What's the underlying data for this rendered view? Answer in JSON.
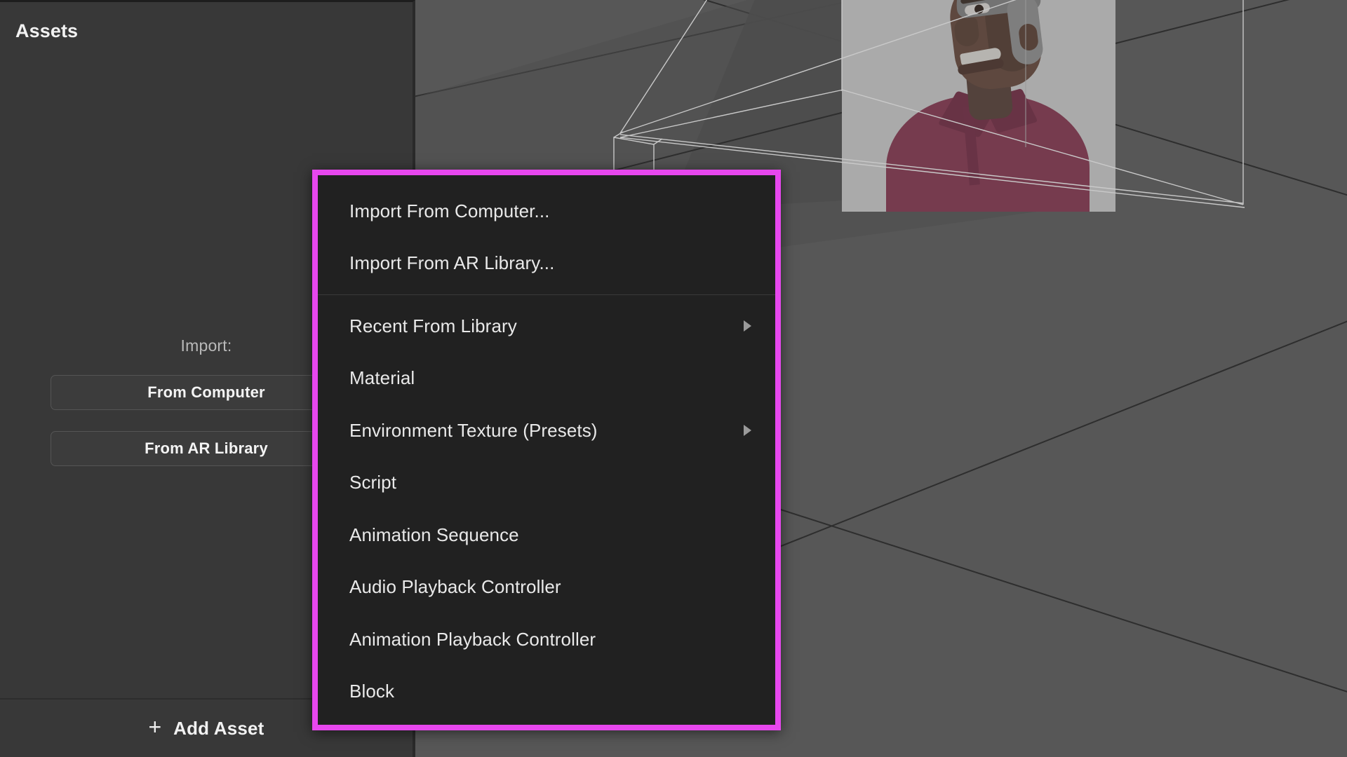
{
  "panel": {
    "title": "Assets",
    "import_label": "Import:",
    "buttons": [
      {
        "label": "From Computer",
        "name": "import-from-computer-button"
      },
      {
        "label": "From AR Library",
        "name": "import-from-ar-library-button"
      }
    ],
    "add_asset": {
      "plus": "+",
      "label": "Add Asset"
    }
  },
  "context_menu": {
    "highlight_color": "#e747ee",
    "background_color": "#212121",
    "groups": [
      {
        "items": [
          {
            "label": "Import From Computer...",
            "submenu": false
          },
          {
            "label": "Import From AR Library...",
            "submenu": false
          }
        ]
      },
      {
        "items": [
          {
            "label": "Recent From Library",
            "submenu": true
          },
          {
            "label": "Material",
            "submenu": false
          },
          {
            "label": "Environment Texture (Presets)",
            "submenu": true
          },
          {
            "label": "Script",
            "submenu": false
          },
          {
            "label": "Animation Sequence",
            "submenu": false
          },
          {
            "label": "Audio Playback Controller",
            "submenu": false
          },
          {
            "label": "Animation Playback Controller",
            "submenu": false
          },
          {
            "label": "Block",
            "submenu": false
          }
        ]
      }
    ]
  },
  "viewport": {
    "background_color": "#575757",
    "wireframe_color": "#2e2e2e",
    "frustum_color": "#c8c8c8",
    "plate_color": "#dcdcdc"
  }
}
